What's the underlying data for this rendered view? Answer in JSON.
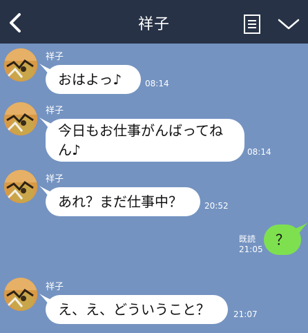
{
  "header": {
    "title": "祥子",
    "back_icon": "chevron-left-icon",
    "notes_icon": "notes-icon",
    "menu_icon": "chevron-down-icon"
  },
  "messages": [
    {
      "sender": "祥子",
      "text": "おはよっ♪",
      "time": "08:14"
    },
    {
      "sender": "祥子",
      "text": "今日もお仕事がんばってね\nん♪",
      "time": "08:14"
    },
    {
      "sender": "祥子",
      "text": "あれ？まだ仕事中？",
      "time": "20:52"
    },
    {
      "sender": "self",
      "text": "？",
      "read": "既読",
      "time": "21:05"
    },
    {
      "sender": "祥子",
      "text": "え、え、どういうこと？",
      "time": "21:07"
    }
  ],
  "colors": {
    "background": "#7493c1",
    "header": "#273246",
    "incoming_bubble": "#ffffff",
    "outgoing_bubble": "#7ee04f"
  }
}
